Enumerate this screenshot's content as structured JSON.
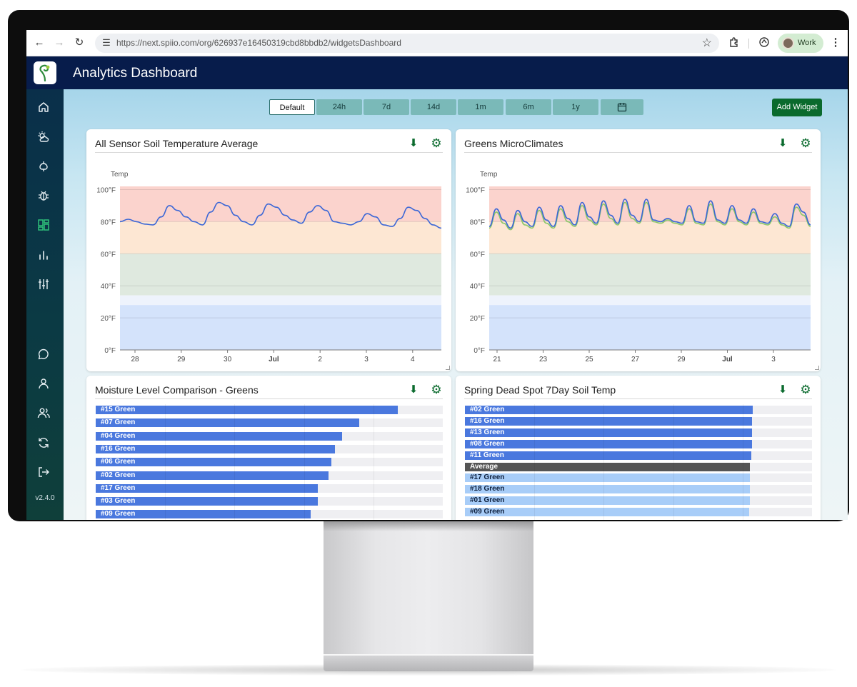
{
  "browser": {
    "url": "https://next.spiio.com/org/626937e16450319cbd8bbdb2/widgetsDashboard",
    "profile_label": "Work"
  },
  "app": {
    "title": "Analytics Dashboard",
    "version": "v2.4.0"
  },
  "sidebar_icons": [
    "home-icon",
    "weather-icon",
    "plant-icon",
    "bug-icon",
    "dashboard-icon",
    "bar-chart-icon",
    "sliders-icon",
    "chat-icon",
    "user-icon",
    "users-icon",
    "refresh-icon",
    "logout-icon"
  ],
  "ranges": {
    "buttons": [
      "Default",
      "24h",
      "7d",
      "14d",
      "1m",
      "6m",
      "1y"
    ],
    "selected": "Default"
  },
  "add_widget_label": "Add Widget",
  "colors": {
    "header": "#071c4b",
    "accent_green": "#0b6b2e",
    "line_blue": "#3a66d6",
    "line_green": "#8cc76a",
    "band_red": "#fbd3cd",
    "band_orange": "#fde7d3",
    "band_green": "#dfe9df",
    "band_blue": "#d4e3fb"
  },
  "widgets": [
    {
      "title": "All Sensor Soil Temperature Average",
      "chart_data": {
        "type": "line",
        "ylabel": "Temp",
        "yticks": [
          "100°F",
          "80°F",
          "60°F",
          "40°F",
          "20°F",
          "0°F"
        ],
        "ylim": [
          0,
          102
        ],
        "xticks": [
          "28",
          "29",
          "30",
          "Jul",
          "2",
          "3",
          "4"
        ],
        "series": [
          {
            "values": [
              80,
              81.5,
              80,
              78.5,
              78,
              83,
              90,
              87,
              83,
              80,
              78,
              86,
              92,
              90,
              84,
              80,
              78,
              84,
              91,
              89,
              84,
              81,
              79,
              86,
              90,
              87,
              80,
              79,
              78,
              80,
              85,
              83,
              78,
              77,
              82,
              89,
              87,
              82,
              78,
              76
            ]
          }
        ]
      }
    },
    {
      "title": "Greens MicroClimates",
      "chart_data": {
        "type": "line",
        "ylabel": "Temp",
        "yticks": [
          "100°F",
          "80°F",
          "60°F",
          "40°F",
          "20°F",
          "0°F"
        ],
        "ylim": [
          0,
          102
        ],
        "xticks": [
          "21",
          "23",
          "25",
          "27",
          "29",
          "Jul",
          "3"
        ],
        "series": [
          {
            "values": [
              76,
              86,
              79,
              75,
              85,
              78,
              76,
              87,
              79,
              76,
              88,
              80,
              77,
              90,
              81,
              78,
              91,
              82,
              78,
              92,
              82,
              79,
              92,
              80,
              79,
              81,
              79,
              78,
              88,
              79,
              78,
              91,
              80,
              78,
              88,
              80,
              78,
              86,
              79,
              78,
              83,
              78,
              76,
              89,
              84,
              77
            ]
          },
          {
            "values": [
              77,
              88,
              81,
              76,
              87,
              80,
              77,
              89,
              81,
              77,
              90,
              82,
              78,
              92,
              83,
              79,
              93,
              84,
              79,
              94,
              84,
              80,
              94,
              81,
              80,
              82,
              80,
              79,
              90,
              80,
              79,
              93,
              81,
              79,
              90,
              81,
              79,
              88,
              80,
              79,
              85,
              79,
              77,
              91,
              86,
              78
            ]
          }
        ]
      }
    },
    {
      "title": "Moisture Level Comparison - Greens",
      "chart_data": {
        "type": "bar",
        "orientation": "horizontal",
        "categories": [
          "#15 Green",
          "#07 Green",
          "#04 Green",
          "#16 Green",
          "#06 Green",
          "#02 Green",
          "#17 Green",
          "#03 Green",
          "#09 Green"
        ],
        "values": [
          87,
          76,
          71,
          69,
          68,
          67,
          64,
          64,
          62
        ],
        "xlim": [
          0,
          100
        ]
      }
    },
    {
      "title": "Spring Dead Spot 7Day Soil Temp",
      "chart_data": {
        "type": "bar",
        "orientation": "horizontal",
        "categories": [
          "#02 Green",
          "#16 Green",
          "#13 Green",
          "#08 Green",
          "#11 Green",
          "Average",
          "#17 Green",
          "#18 Green",
          "#01 Green",
          "#09 Green"
        ],
        "values": [
          83,
          82.8,
          82.8,
          82.7,
          82.6,
          82.2,
          82.1,
          82.0,
          82.0,
          81.9
        ],
        "xlim": [
          0,
          100
        ]
      }
    }
  ]
}
